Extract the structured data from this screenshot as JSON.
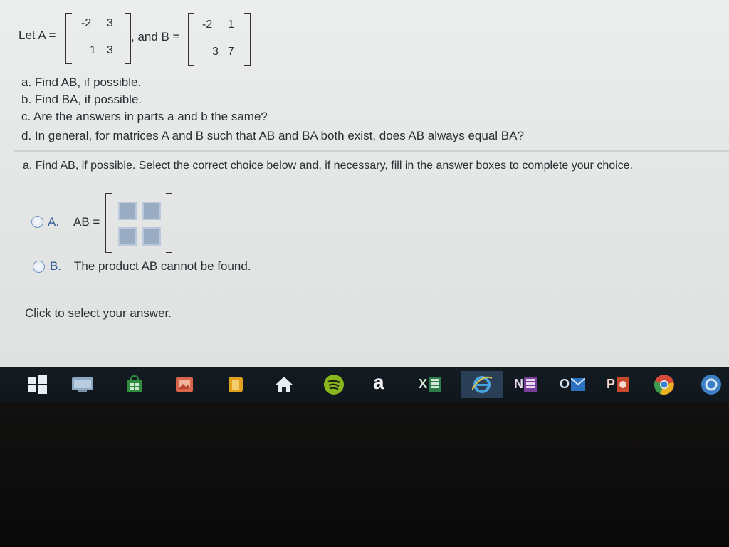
{
  "problem": {
    "intro": "Let A =",
    "matrix_a": [
      [
        "-2",
        "3"
      ],
      [
        "1",
        "3"
      ]
    ],
    "and_b": ", and B =",
    "matrix_b": [
      [
        "-2",
        "1"
      ],
      [
        "3",
        "7"
      ]
    ],
    "parts": [
      "a. Find AB, if possible.",
      "b. Find BA, if possible.",
      "c. Are the answers in parts a and b the same?",
      "d. In general, for matrices A and B such that AB and BA both exist, does AB always equal BA?"
    ]
  },
  "question": {
    "instruction": "a. Find AB, if possible. Select the correct choice below and, if necessary, fill in the answer boxes to complete your choice."
  },
  "choices": [
    {
      "letter": "A.",
      "label": "AB ="
    },
    {
      "letter": "B.",
      "label": "The product AB cannot be found."
    }
  ],
  "footer": {
    "hint": "Click to select your answer."
  },
  "taskbar": {
    "icons": [
      "windows-start-icon",
      "computer-icon",
      "store-icon",
      "photos-icon",
      "notes-icon",
      "home-icon",
      "spotify-icon",
      "amazon-icon",
      "excel-icon",
      "internet-explorer-icon",
      "onenote-icon",
      "outlook-icon",
      "powerpoint-icon",
      "chrome-icon",
      "app-icon"
    ],
    "amazon_letter": "a",
    "excel_letter": "X",
    "onenote_letter": "N",
    "outlook_letter": "O",
    "powerpoint_letter": "P"
  }
}
